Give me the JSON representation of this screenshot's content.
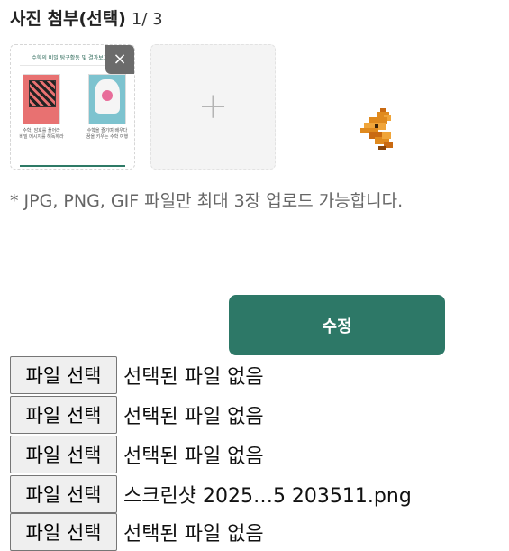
{
  "attach": {
    "title": "사진 첨부(선택)",
    "count": "1/ 3",
    "remove_label": "×",
    "add_label": "+",
    "preview": {
      "header": "수학의 비밀 탐구활동 및 결과보고서",
      "caption_left": "수학, 암호를 풀어라\n비밀 메시지를 해독하라",
      "caption_right": "수학을 즐기며 배우다\n꿈을 키우는 수학 여행"
    }
  },
  "notice": "* JPG, PNG, GIF 파일만 최대 3장 업로드 가능합니다.",
  "submit_label": "수정",
  "file_inputs": [
    {
      "button": "파일 선택",
      "status": "선택된 파일 없음"
    },
    {
      "button": "파일 선택",
      "status": "선택된 파일 없음"
    },
    {
      "button": "파일 선택",
      "status": "선택된 파일 없음"
    },
    {
      "button": "파일 선택",
      "status": "스크린샷 2025…5 203511.png"
    },
    {
      "button": "파일 선택",
      "status": "선택된 파일 없음"
    }
  ],
  "colors": {
    "accent": "#2d7867",
    "remove_bg": "#6b6b6b",
    "add_bg": "#f4f4f4"
  }
}
